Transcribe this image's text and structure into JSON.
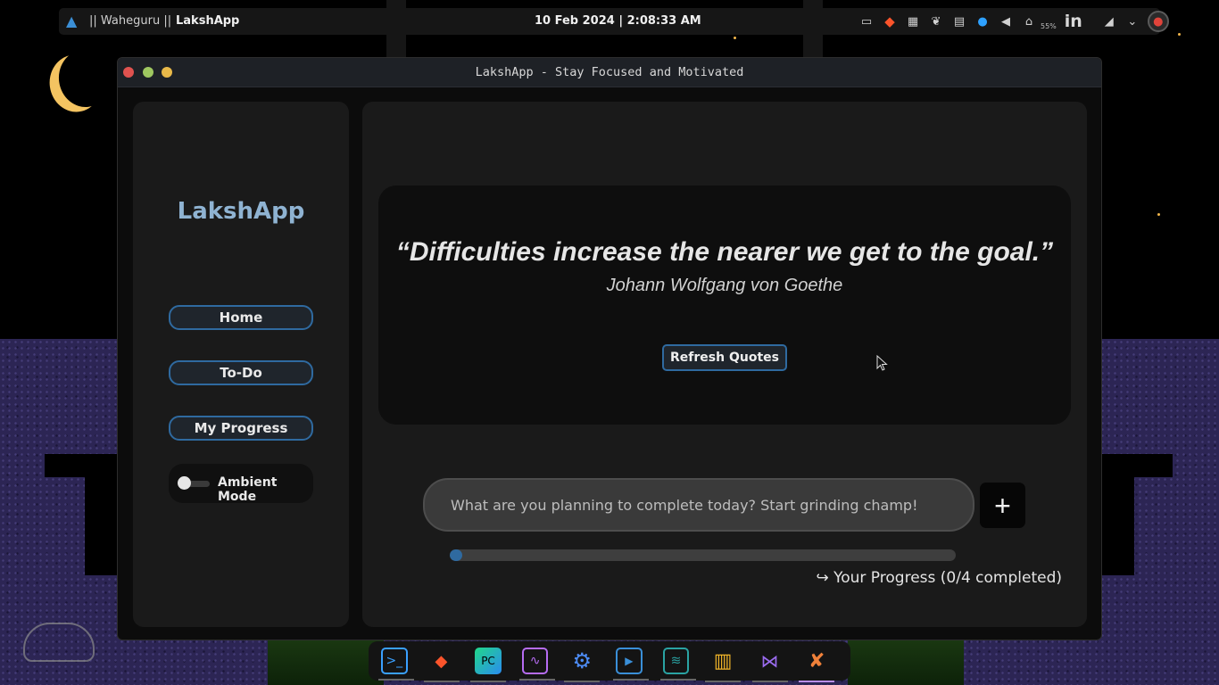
{
  "top_panel": {
    "workspace_label": "|| Waheguru ||",
    "active_app": "LakshApp",
    "clock": "10 Feb 2024 | 2:08:33 AM",
    "battery_percent": "55%",
    "linkedin_text": "in",
    "tray_icons": [
      "subtitles-icon",
      "brave-icon",
      "firewall-icon",
      "leaf-icon",
      "clipboard-icon",
      "bulb-icon",
      "volume-icon",
      "battery-icon",
      "linkedin-icon",
      "wifi-icon",
      "chevron-down-icon",
      "user-avatar-icon"
    ]
  },
  "window": {
    "title": "LakshApp - Stay Focused and Motivated"
  },
  "sidebar": {
    "brand": "LakshApp",
    "nav": {
      "home": "Home",
      "todo": "To-Do",
      "progress": "My Progress"
    },
    "ambient_label": "Ambient Mode",
    "ambient_on": false
  },
  "quote": {
    "text": "“Difficulties increase the nearer we get to the goal.”",
    "author": "Johann Wolfgang von Goethe",
    "refresh_label": "Refresh Quotes"
  },
  "task": {
    "placeholder": "What are you planning to complete today? Start grinding champ!",
    "value": "",
    "add_label": "+"
  },
  "progress": {
    "completed": 0,
    "total": 4,
    "fraction": 0,
    "text": "↪ Your Progress (0/4 completed)"
  },
  "dock": {
    "apps": [
      "terminal-icon",
      "brave-icon",
      "pycharm-icon",
      "system-monitor-icon",
      "settings-icon",
      "store-icon",
      "spotify-icon",
      "book-icon",
      "visual-studio-icon",
      "lakshapp-icon"
    ]
  },
  "colors": {
    "accent": "#2f6aa0",
    "brand_text": "#8fb3d2",
    "panel_bg": "#1a1a1a"
  }
}
